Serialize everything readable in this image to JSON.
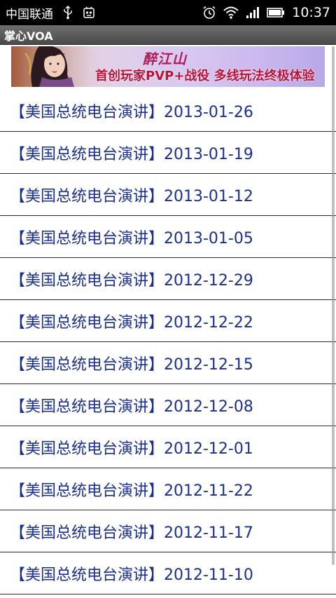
{
  "status_bar": {
    "carrier": "中国联通",
    "time": "10:37",
    "icons": [
      "usb-icon",
      "notification-app-icon",
      "alarm-icon",
      "wifi-icon",
      "signal-icon",
      "battery-icon"
    ]
  },
  "app": {
    "title": "掌心VOA"
  },
  "banner": {
    "logo_text": "醉江山",
    "text": "首创玩家PVP+战役  多线玩法终极体验"
  },
  "list": {
    "items": [
      {
        "label": "【美国总统电台演讲】2013-01-26"
      },
      {
        "label": "【美国总统电台演讲】2013-01-19"
      },
      {
        "label": "【美国总统电台演讲】2013-01-12"
      },
      {
        "label": "【美国总统电台演讲】2013-01-05"
      },
      {
        "label": "【美国总统电台演讲】2012-12-29"
      },
      {
        "label": "【美国总统电台演讲】2012-12-22"
      },
      {
        "label": "【美国总统电台演讲】2012-12-15"
      },
      {
        "label": "【美国总统电台演讲】2012-12-08"
      },
      {
        "label": "【美国总统电台演讲】2012-12-01"
      },
      {
        "label": "【美国总统电台演讲】2012-11-22"
      },
      {
        "label": "【美国总统电台演讲】2012-11-17"
      },
      {
        "label": "【美国总统电台演讲】2012-11-10"
      }
    ]
  },
  "colors": {
    "list_text": "#1b2f8f",
    "banner_text": "#b8113a",
    "status_bar_bg": "#000000"
  }
}
